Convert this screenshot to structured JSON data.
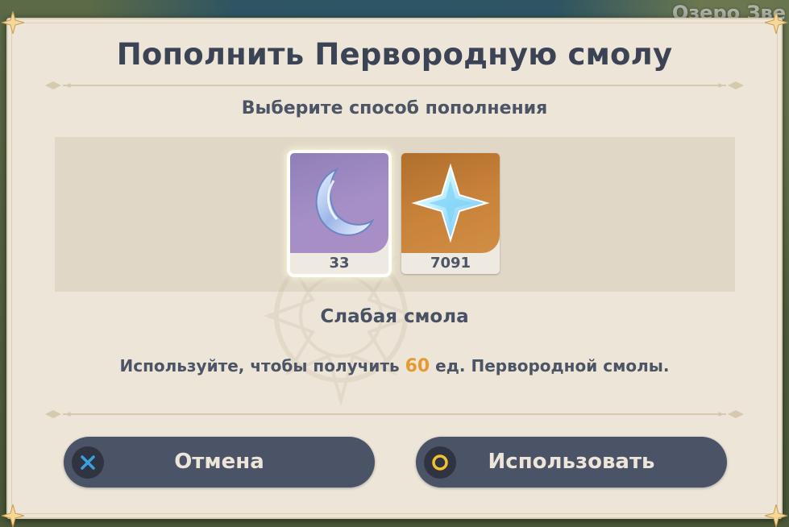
{
  "map": {
    "location_label": "Озеро Зве"
  },
  "dialog": {
    "title": "Пополнить Первородную смолу",
    "subtitle": "Выберите способ пополнения",
    "items": [
      {
        "icon": "fragile-resin-icon",
        "count": "33",
        "selected": true,
        "color": "#a68fc7"
      },
      {
        "icon": "primogem-icon",
        "count": "7091",
        "selected": false,
        "color": "#c9833b"
      }
    ],
    "selected_item_name": "Слабая смола",
    "description": {
      "before": "Используйте, чтобы получить ",
      "amount": "60",
      "after": " ед. Первородной смолы."
    },
    "buttons": {
      "cancel_label": "Отмена",
      "confirm_label": "Использовать"
    }
  },
  "colors": {
    "dialog_bg": "#ece5d8",
    "panel_bg": "#e0d7c6",
    "button_bg": "#4b5366",
    "accent_amount": "#e59a2f",
    "cancel_icon": "#3aa0e0",
    "confirm_icon": "#f1c232"
  }
}
